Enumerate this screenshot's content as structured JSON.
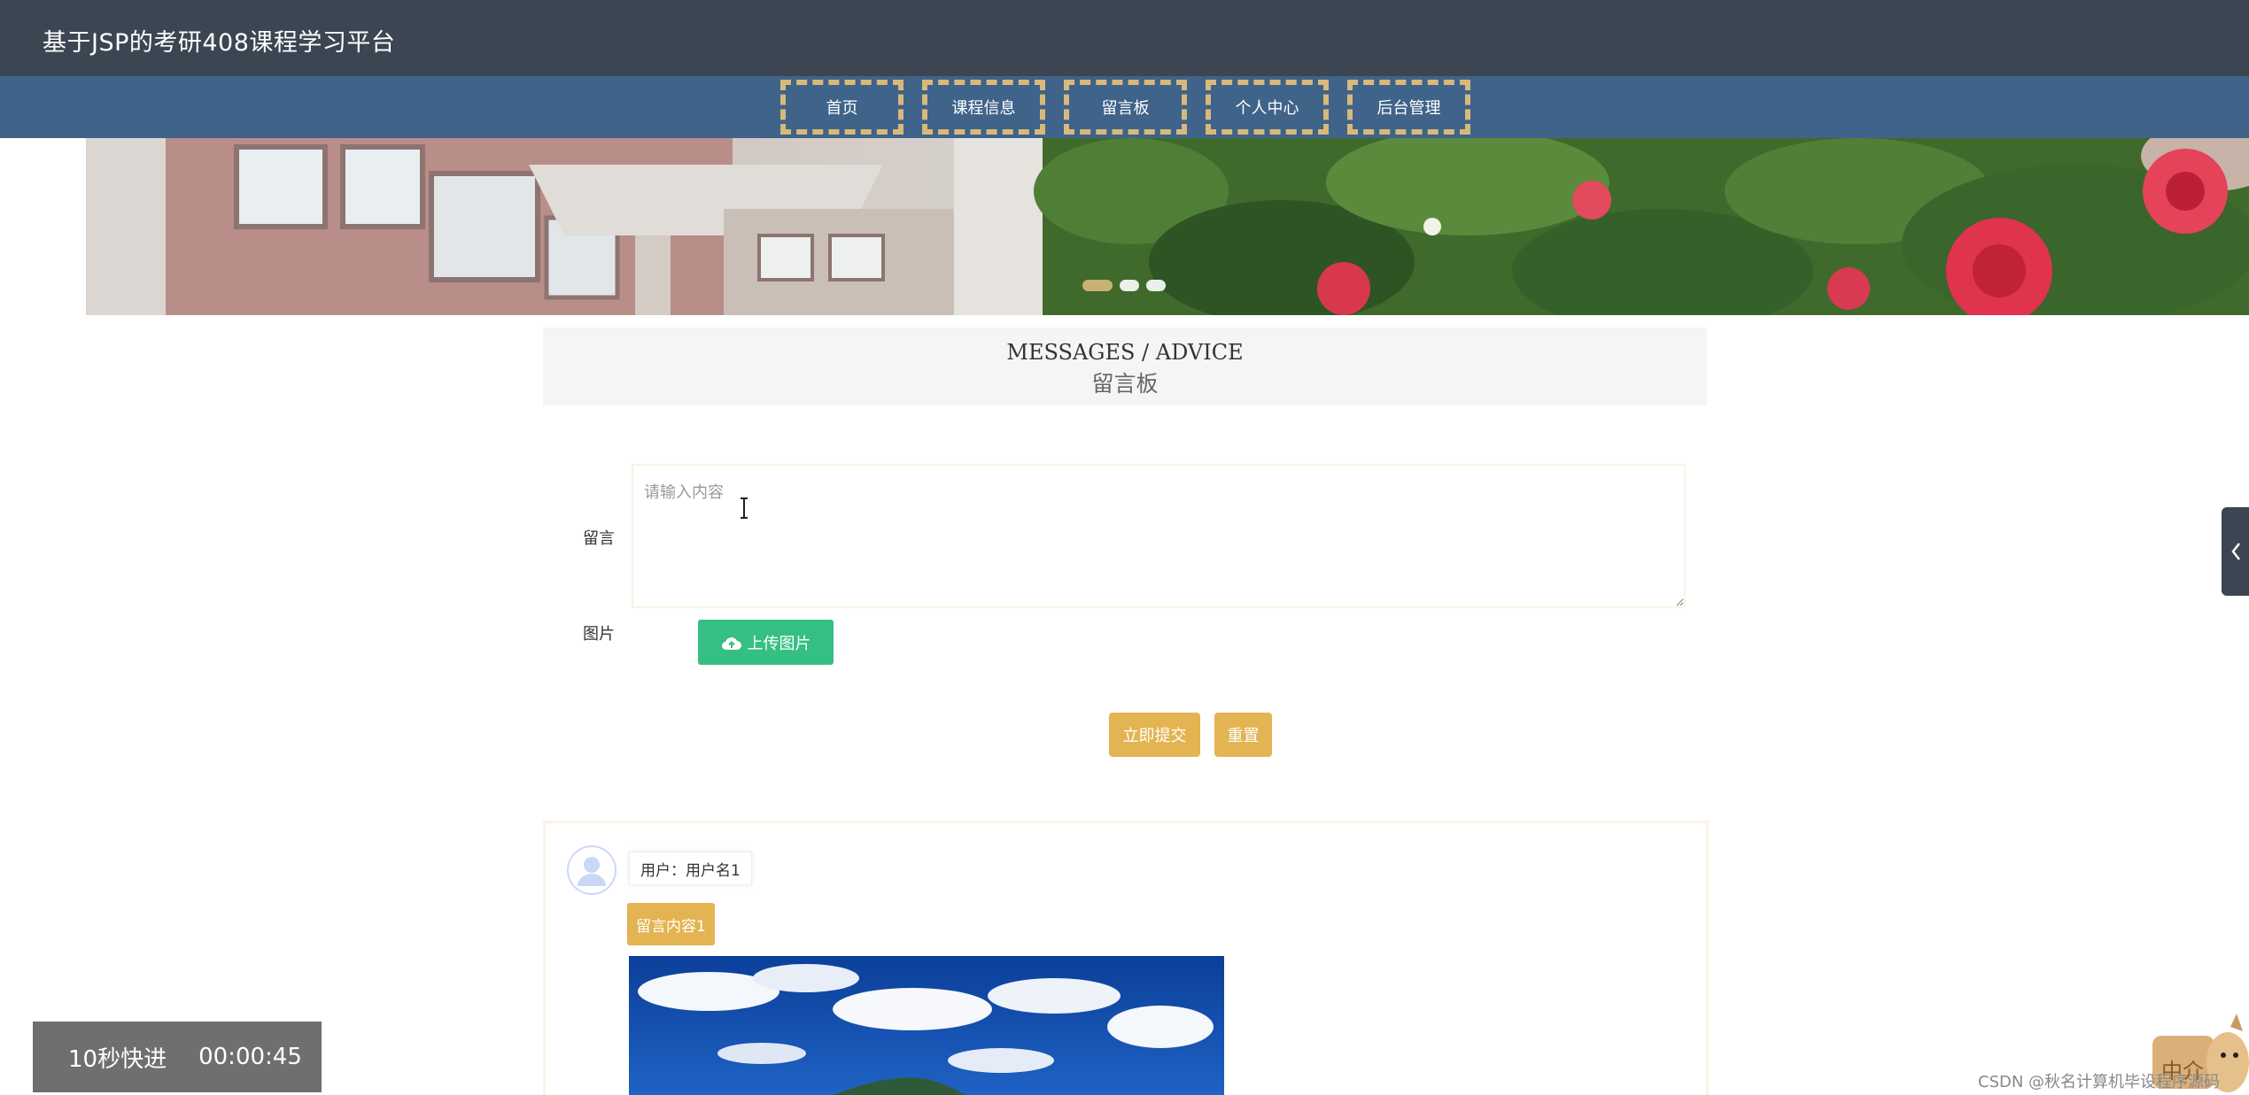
{
  "header": {
    "site_title": "基于JSP的考研408课程学习平台"
  },
  "nav": {
    "items": [
      {
        "label": "首页"
      },
      {
        "label": "课程信息"
      },
      {
        "label": "留言板"
      },
      {
        "label": "个人中心"
      },
      {
        "label": "后台管理"
      }
    ]
  },
  "banner": {
    "slide_count": 3,
    "active_index": 0
  },
  "section": {
    "title_en": "MESSAGES / ADVICE",
    "title_zh": "留言板"
  },
  "form": {
    "message_label": "留言",
    "message_placeholder": "请输入内容",
    "image_label": "图片",
    "upload_label": "上传图片",
    "submit_label": "立即提交",
    "reset_label": "重置"
  },
  "messages": [
    {
      "user": "用户：用户名1",
      "content": "留言内容1"
    }
  ],
  "player": {
    "skip_label": "10秒快进",
    "time": "00:00:45"
  },
  "watermark": "CSDN @秋名计算机毕设程序源码",
  "mascot_label": "中介",
  "colors": {
    "header_bg": "#3b4652",
    "nav_bg": "#3f6389",
    "accent_gold": "#e3b451",
    "upload_green": "#35bf83"
  }
}
